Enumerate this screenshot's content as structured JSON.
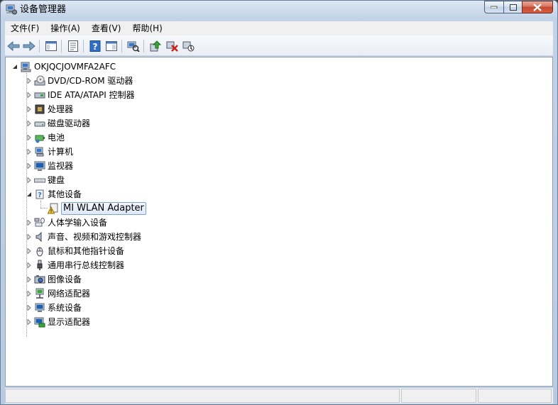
{
  "window": {
    "title": "设备管理器",
    "accent": "#c2d3e8",
    "close_color": "#c44a32",
    "icons": {
      "title": "device-manager-icon",
      "min": "minimize-icon",
      "max": "maximize-icon",
      "close": "close-icon"
    }
  },
  "menu": {
    "items": [
      {
        "label": "文件(F)",
        "name": "menu-file"
      },
      {
        "label": "操作(A)",
        "name": "menu-action"
      },
      {
        "label": "查看(V)",
        "name": "menu-view"
      },
      {
        "label": "帮助(H)",
        "name": "menu-help"
      }
    ]
  },
  "toolbar": {
    "buttons": [
      {
        "icon": "back-arrow-icon"
      },
      {
        "icon": "forward-arrow-icon"
      },
      {
        "icon": "show-hide-console-tree-icon"
      },
      {
        "icon": "properties-icon"
      },
      {
        "icon": "help-icon"
      },
      {
        "icon": "show-action-pane-icon"
      },
      {
        "icon": "scan-hardware-changes-icon"
      },
      {
        "icon": "update-driver-icon"
      },
      {
        "icon": "uninstall-icon"
      },
      {
        "icon": "disable-device-icon"
      }
    ]
  },
  "tree": {
    "root": {
      "label": "OKJQCJOVMFA2AFC",
      "icon": "computer-icon",
      "expanded": true
    },
    "categories": [
      {
        "label": "DVD/CD-ROM 驱动器",
        "icon": "dvd-drive-icon",
        "expanded": false
      },
      {
        "label": "IDE ATA/ATAPI 控制器",
        "icon": "ide-controller-icon",
        "expanded": false
      },
      {
        "label": "处理器",
        "icon": "processor-icon",
        "expanded": false
      },
      {
        "label": "磁盘驱动器",
        "icon": "disk-drive-icon",
        "expanded": false
      },
      {
        "label": "电池",
        "icon": "battery-icon",
        "expanded": false
      },
      {
        "label": "计算机",
        "icon": "computer-icon",
        "expanded": false
      },
      {
        "label": "监视器",
        "icon": "monitor-icon",
        "expanded": false
      },
      {
        "label": "键盘",
        "icon": "keyboard-icon",
        "expanded": false
      },
      {
        "label": "其他设备",
        "icon": "unknown-device-icon",
        "expanded": true,
        "children": [
          {
            "label": "MI WLAN Adapter",
            "icon": "warning-device-icon",
            "selected": true
          }
        ]
      },
      {
        "label": "人体学输入设备",
        "icon": "hid-icon",
        "expanded": false
      },
      {
        "label": "声音、视频和游戏控制器",
        "icon": "speaker-icon",
        "expanded": false
      },
      {
        "label": "鼠标和其他指针设备",
        "icon": "mouse-icon",
        "expanded": false
      },
      {
        "label": "通用串行总线控制器",
        "icon": "usb-icon",
        "expanded": false
      },
      {
        "label": "图像设备",
        "icon": "camera-icon",
        "expanded": false
      },
      {
        "label": "网络适配器",
        "icon": "network-adapter-icon",
        "expanded": false
      },
      {
        "label": "系统设备",
        "icon": "system-device-icon",
        "expanded": false
      },
      {
        "label": "显示适配器",
        "icon": "display-adapter-icon",
        "expanded": false
      }
    ]
  },
  "statusbar": {
    "text": ""
  }
}
